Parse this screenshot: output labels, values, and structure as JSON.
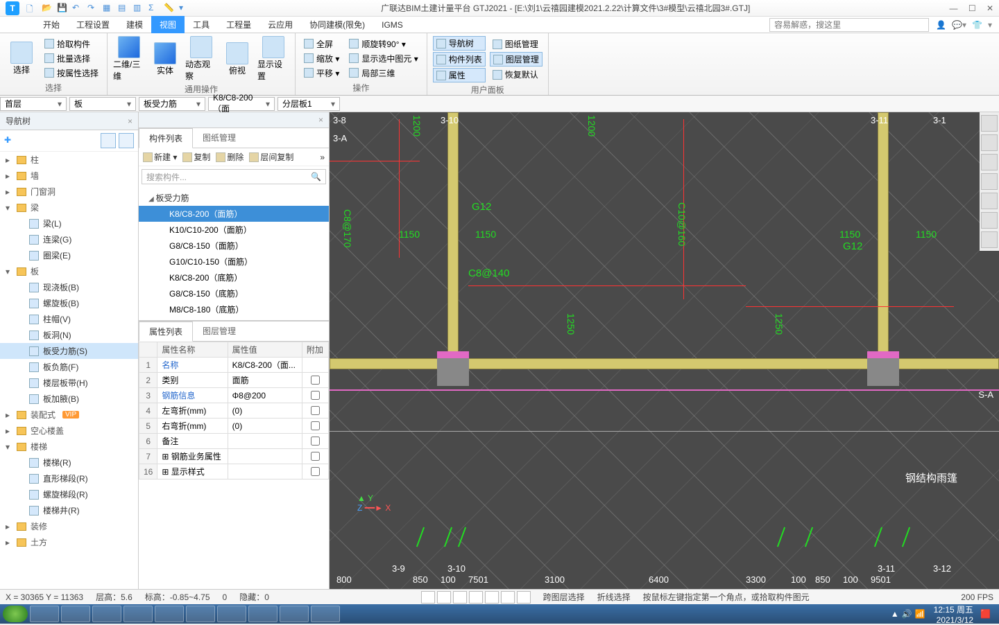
{
  "title": "广联达BIM土建计量平台 GTJ2021 - [E:\\刘1\\云禧园建模2021.2.22\\计算文件\\3#模型\\云禧北园3#.GTJ]",
  "window": {
    "min": "—",
    "max": "☐",
    "close": "✕"
  },
  "search_placeholder": "容易解惑，搜这里",
  "ribbon_tabs": [
    "开始",
    "工程设置",
    "建模",
    "视图",
    "工具",
    "工程量",
    "云应用",
    "协同建模(限免)",
    "IGMS"
  ],
  "ribbon_active_index": 3,
  "ribbon": {
    "g1": {
      "label": "选择",
      "select": "选择",
      "items": [
        "拾取构件",
        "批量选择",
        "按属性选择"
      ]
    },
    "g2": {
      "label": "通用操作",
      "btns": [
        "二维/三维",
        "实体",
        "动态观察",
        "俯视",
        "显示设置"
      ]
    },
    "g3": {
      "label": "操作",
      "items": [
        "全屏",
        "缩放 ▾",
        "平移 ▾",
        "顺旋转90° ▾",
        "显示选中图元 ▾",
        "局部三维"
      ]
    },
    "g4": {
      "label": "用户面板",
      "items": [
        "导航树",
        "构件列表",
        "属性",
        "图纸管理",
        "图层管理",
        "恢复默认"
      ]
    }
  },
  "selectors": {
    "floor": "首层",
    "cat": "板",
    "sub": "板受力筋",
    "item": "K8/C8-200（面",
    "layer": "分层板1"
  },
  "nav": {
    "title": "导航树",
    "cats": [
      {
        "name": "柱",
        "open": false
      },
      {
        "name": "墙",
        "open": false
      },
      {
        "name": "门窗洞",
        "open": false
      },
      {
        "name": "梁",
        "open": true,
        "items": [
          "梁(L)",
          "连梁(G)",
          "圈梁(E)"
        ]
      },
      {
        "name": "板",
        "open": true,
        "items": [
          "现浇板(B)",
          "螺旋板(B)",
          "柱帽(V)",
          "板洞(N)",
          "板受力筋(S)",
          "板负筋(F)",
          "楼层板带(H)",
          "板加腋(B)"
        ],
        "selected": "板受力筋(S)"
      },
      {
        "name": "装配式",
        "vip": true,
        "open": false
      },
      {
        "name": "空心楼盖",
        "open": false
      },
      {
        "name": "楼梯",
        "open": true,
        "items": [
          "楼梯(R)",
          "直形梯段(R)",
          "螺旋梯段(R)",
          "楼梯井(R)"
        ]
      },
      {
        "name": "装修",
        "open": false
      },
      {
        "name": "土方",
        "open": false
      }
    ]
  },
  "comp": {
    "tabs": [
      "构件列表",
      "图纸管理"
    ],
    "toolbar": [
      "新建 ▾",
      "复制",
      "删除",
      "层间复制"
    ],
    "search_placeholder": "搜索构件...",
    "group": "板受力筋",
    "items": [
      "K8/C8-200（面筋）",
      "K10/C10-200（面筋）",
      "G8/C8-150（面筋）",
      "G10/C10-150（面筋）",
      "K8/C8-200（底筋）",
      "G8/C8-150（底筋）",
      "M8/C8-180（底筋）"
    ],
    "selected_index": 0
  },
  "props": {
    "tabs": [
      "属性列表",
      "图层管理"
    ],
    "headers": [
      "",
      "属性名称",
      "属性值",
      "附加"
    ],
    "rows": [
      {
        "n": "1",
        "name": "名称",
        "value": "K8/C8-200（面...",
        "link": true,
        "chk": false,
        "nochk": true
      },
      {
        "n": "2",
        "name": "类别",
        "value": "面筋",
        "chk": false
      },
      {
        "n": "3",
        "name": "钢筋信息",
        "value": "Φ8@200",
        "chk": false,
        "link": true
      },
      {
        "n": "4",
        "name": "左弯折(mm)",
        "value": "(0)",
        "chk": false
      },
      {
        "n": "5",
        "name": "右弯折(mm)",
        "value": "(0)",
        "chk": false
      },
      {
        "n": "6",
        "name": "备注",
        "value": "",
        "chk": false
      },
      {
        "n": "7",
        "name": "钢筋业务属性",
        "value": "",
        "expand": true
      },
      {
        "n": "16",
        "name": "显示样式",
        "value": "",
        "expand": true
      }
    ]
  },
  "canvas": {
    "grid_top": [
      "3-8",
      "3-10",
      "3-11",
      "3-1"
    ],
    "grid_left": [
      "3-A"
    ],
    "grid_right": [
      "S-A"
    ],
    "grid_bottom": [
      "3-9",
      "3-10",
      "3-11",
      "3-12"
    ],
    "dims_top": [
      "1200",
      "1200"
    ],
    "dims_row1": [
      "1150",
      "1150",
      "1150",
      "1150"
    ],
    "dims_side": [
      "C8@170",
      "1250",
      "C10@160",
      "1250"
    ],
    "annos": [
      "G12",
      "C8@140",
      "G12"
    ],
    "bottom_dims": [
      "800",
      "850",
      "100",
      "7501",
      "3100",
      "6400",
      "3300",
      "100",
      "850",
      "100",
      "9501"
    ],
    "white_anno": "钢结构雨篷"
  },
  "status": {
    "coords": "X = 30365 Y = 11363",
    "floor_h": "层高：5.6",
    "elev": "标高：-0.85~4.75",
    "elev_v": "0",
    "hidden": "隐藏：0",
    "mode1": "跨图层选择",
    "mode2": "折线选择",
    "hint": "按鼠标左键指定第一个角点，或拾取构件图元",
    "fps": "200 FPS"
  },
  "tray": {
    "time": "12:15 周五",
    "date": "2021/3/12"
  }
}
